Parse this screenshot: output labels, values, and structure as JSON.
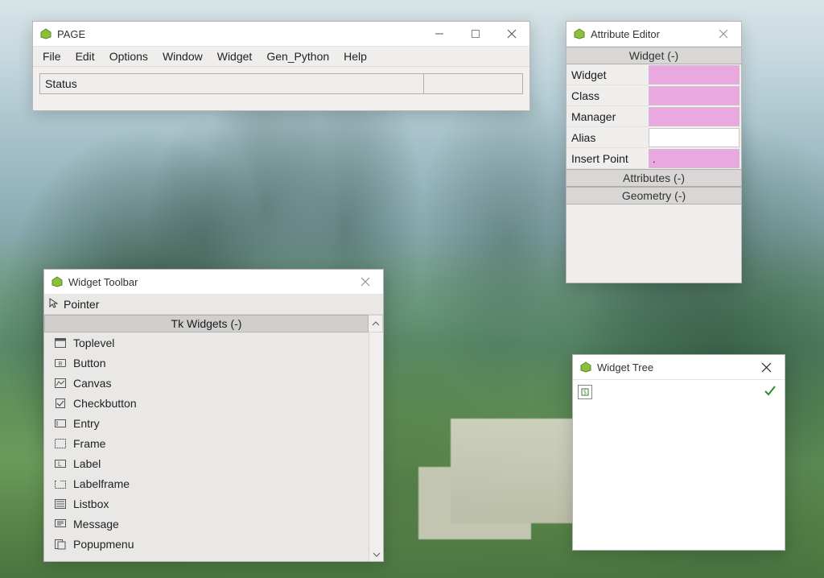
{
  "main_window": {
    "title": "PAGE",
    "menu": [
      "File",
      "Edit",
      "Options",
      "Window",
      "Widget",
      "Gen_Python",
      "Help"
    ],
    "status_text": "Status"
  },
  "attribute_editor": {
    "title": "Attribute Editor",
    "section_widget_header": "Widget (-)",
    "rows": [
      {
        "label": "Widget",
        "value": "",
        "style": "pink"
      },
      {
        "label": "Class",
        "value": "",
        "style": "pink"
      },
      {
        "label": "Manager",
        "value": "",
        "style": "pink"
      },
      {
        "label": "Alias",
        "value": "",
        "style": "white"
      },
      {
        "label": "Insert Point",
        "value": ".",
        "style": "pink"
      }
    ],
    "section_attributes_header": "Attributes (-)",
    "section_geometry_header": "Geometry (-)"
  },
  "widget_toolbar": {
    "title": "Widget Toolbar",
    "pointer_label": "Pointer",
    "group_header": "Tk Widgets (-)",
    "items": [
      "Toplevel",
      "Button",
      "Canvas",
      "Checkbutton",
      "Entry",
      "Frame",
      "Label",
      "Labelframe",
      "Listbox",
      "Message",
      "Popupmenu"
    ]
  },
  "widget_tree": {
    "title": "Widget Tree"
  }
}
